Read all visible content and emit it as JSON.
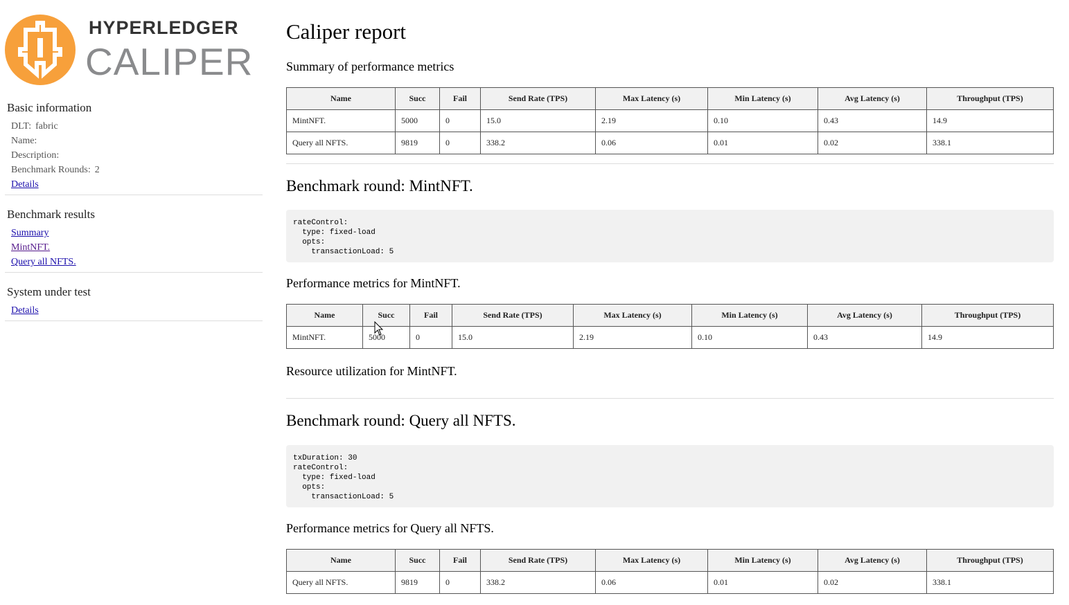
{
  "logo": {
    "top_text": "HYPERLEDGER",
    "bottom_text": "CALIPER",
    "accent": "#f7a03b"
  },
  "sidebar": {
    "basic": {
      "heading": "Basic information",
      "dlt_label": "DLT:",
      "dlt_value": "fabric",
      "name_label": "Name:",
      "desc_label": "Description:",
      "rounds_label": "Benchmark Rounds:",
      "rounds_value": "2",
      "details_link": "Details"
    },
    "results": {
      "heading": "Benchmark results",
      "links": [
        "Summary",
        "MintNFT.",
        "Query all NFTS."
      ]
    },
    "system": {
      "heading": "System under test",
      "details_link": "Details"
    }
  },
  "main": {
    "title": "Caliper report",
    "summary_heading": "Summary of performance metrics",
    "columns": [
      "Name",
      "Succ",
      "Fail",
      "Send Rate (TPS)",
      "Max Latency (s)",
      "Min Latency (s)",
      "Avg Latency (s)",
      "Throughput (TPS)"
    ],
    "summary_rows": [
      [
        "MintNFT.",
        "5000",
        "0",
        "15.0",
        "2.19",
        "0.10",
        "0.43",
        "14.9"
      ],
      [
        "Query all NFTS.",
        "9819",
        "0",
        "338.2",
        "0.06",
        "0.01",
        "0.02",
        "338.1"
      ]
    ],
    "round1": {
      "title": "Benchmark round: MintNFT.",
      "config": "rateControl:\n  type: fixed-load\n  opts:\n    transactionLoad: 5",
      "perf_heading": "Performance metrics for MintNFT.",
      "row": [
        "MintNFT.",
        "5000",
        "0",
        "15.0",
        "2.19",
        "0.10",
        "0.43",
        "14.9"
      ],
      "resource_heading": "Resource utilization for MintNFT."
    },
    "round2": {
      "title": "Benchmark round: Query all NFTS.",
      "config": "txDuration: 30\nrateControl:\n  type: fixed-load\n  opts:\n    transactionLoad: 5",
      "perf_heading": "Performance metrics for Query all NFTS.",
      "row": [
        "Query all NFTS.",
        "9819",
        "0",
        "338.2",
        "0.06",
        "0.01",
        "0.02",
        "338.1"
      ]
    }
  }
}
